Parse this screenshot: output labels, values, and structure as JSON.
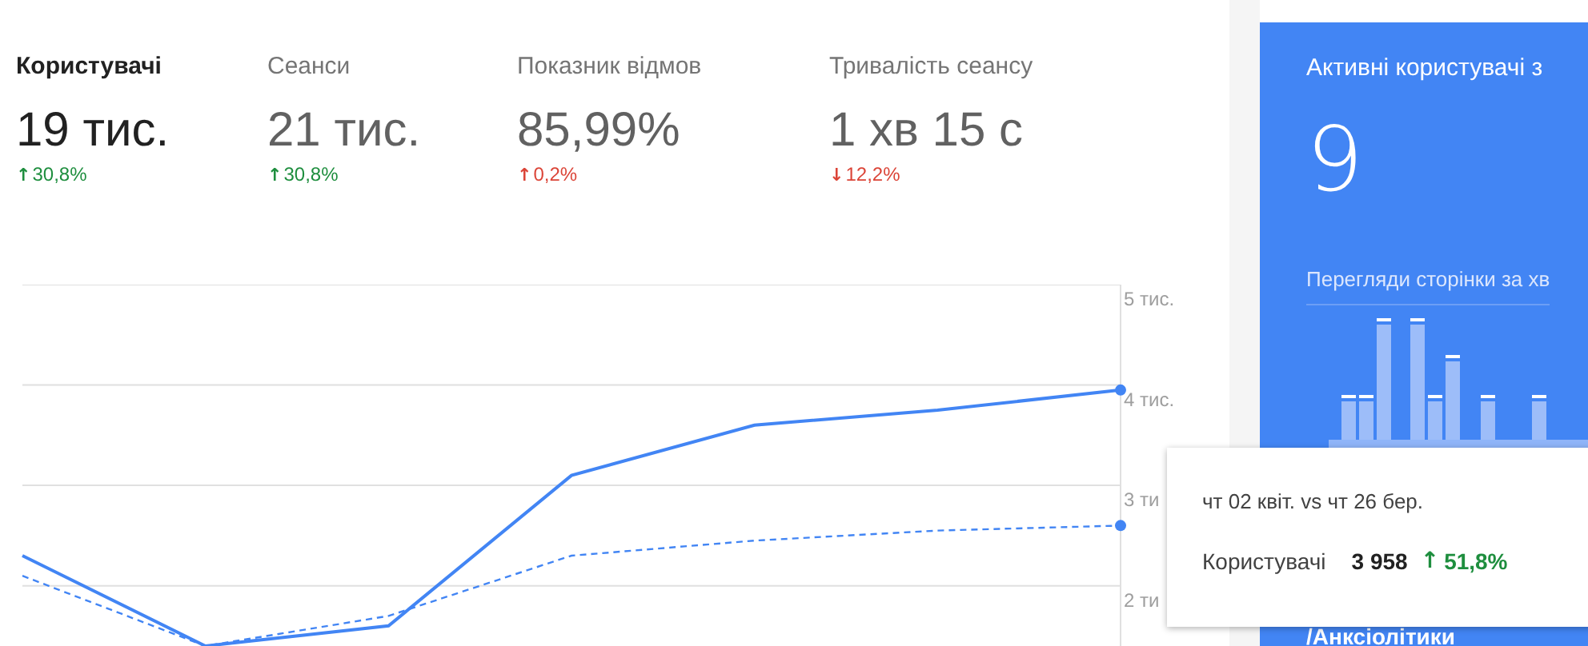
{
  "metrics": [
    {
      "label": "Користувачі",
      "value": "19 тис.",
      "arrow": "↑",
      "change": "30,8%",
      "color": "#1e8e3e",
      "selected": true
    },
    {
      "label": "Сеанси",
      "value": "21 тис.",
      "arrow": "↑",
      "change": "30,8%",
      "color": "#1e8e3e",
      "selected": false
    },
    {
      "label": "Показник відмов",
      "value": "85,99%",
      "arrow": "↑",
      "change": "0,2%",
      "color": "#db4437",
      "selected": false
    },
    {
      "label": "Тривалість сеансу",
      "value": "1 хв 15 с",
      "arrow": "↓",
      "change": "12,2%",
      "color": "#db4437",
      "selected": false
    }
  ],
  "chart": {
    "chart_data": {
      "type": "line",
      "grid": true,
      "ylim": [
        1.4,
        5
      ],
      "yticks": [
        {
          "value": 2,
          "label": "2 ти"
        },
        {
          "value": 3,
          "label": "3 ти"
        },
        {
          "value": 4,
          "label": "4 тис."
        },
        {
          "value": 5,
          "label": "5 тис."
        }
      ],
      "series": [
        {
          "color": "#4285f4",
          "line_style": "solid",
          "values": [
            2.3,
            1.4,
            1.6,
            3.1,
            3.6,
            3.75,
            3.95
          ]
        },
        {
          "color": "#4285f4",
          "line_style": "dashed",
          "values": [
            2.1,
            1.4,
            1.7,
            2.3,
            2.45,
            2.55,
            2.6
          ]
        }
      ]
    }
  },
  "tooltip": {
    "title": "чт 02 квіт. vs чт 26 бер.",
    "metric": "Користувачі",
    "value": "3 958",
    "arrow": "↑",
    "change": "51,8%",
    "color": "#1e8e3e"
  },
  "realtime": {
    "title": "Активні користувачі з",
    "count": "9",
    "subtitle": "Перегляди сторінки за хв",
    "page": "/Анксіолітики"
  }
}
